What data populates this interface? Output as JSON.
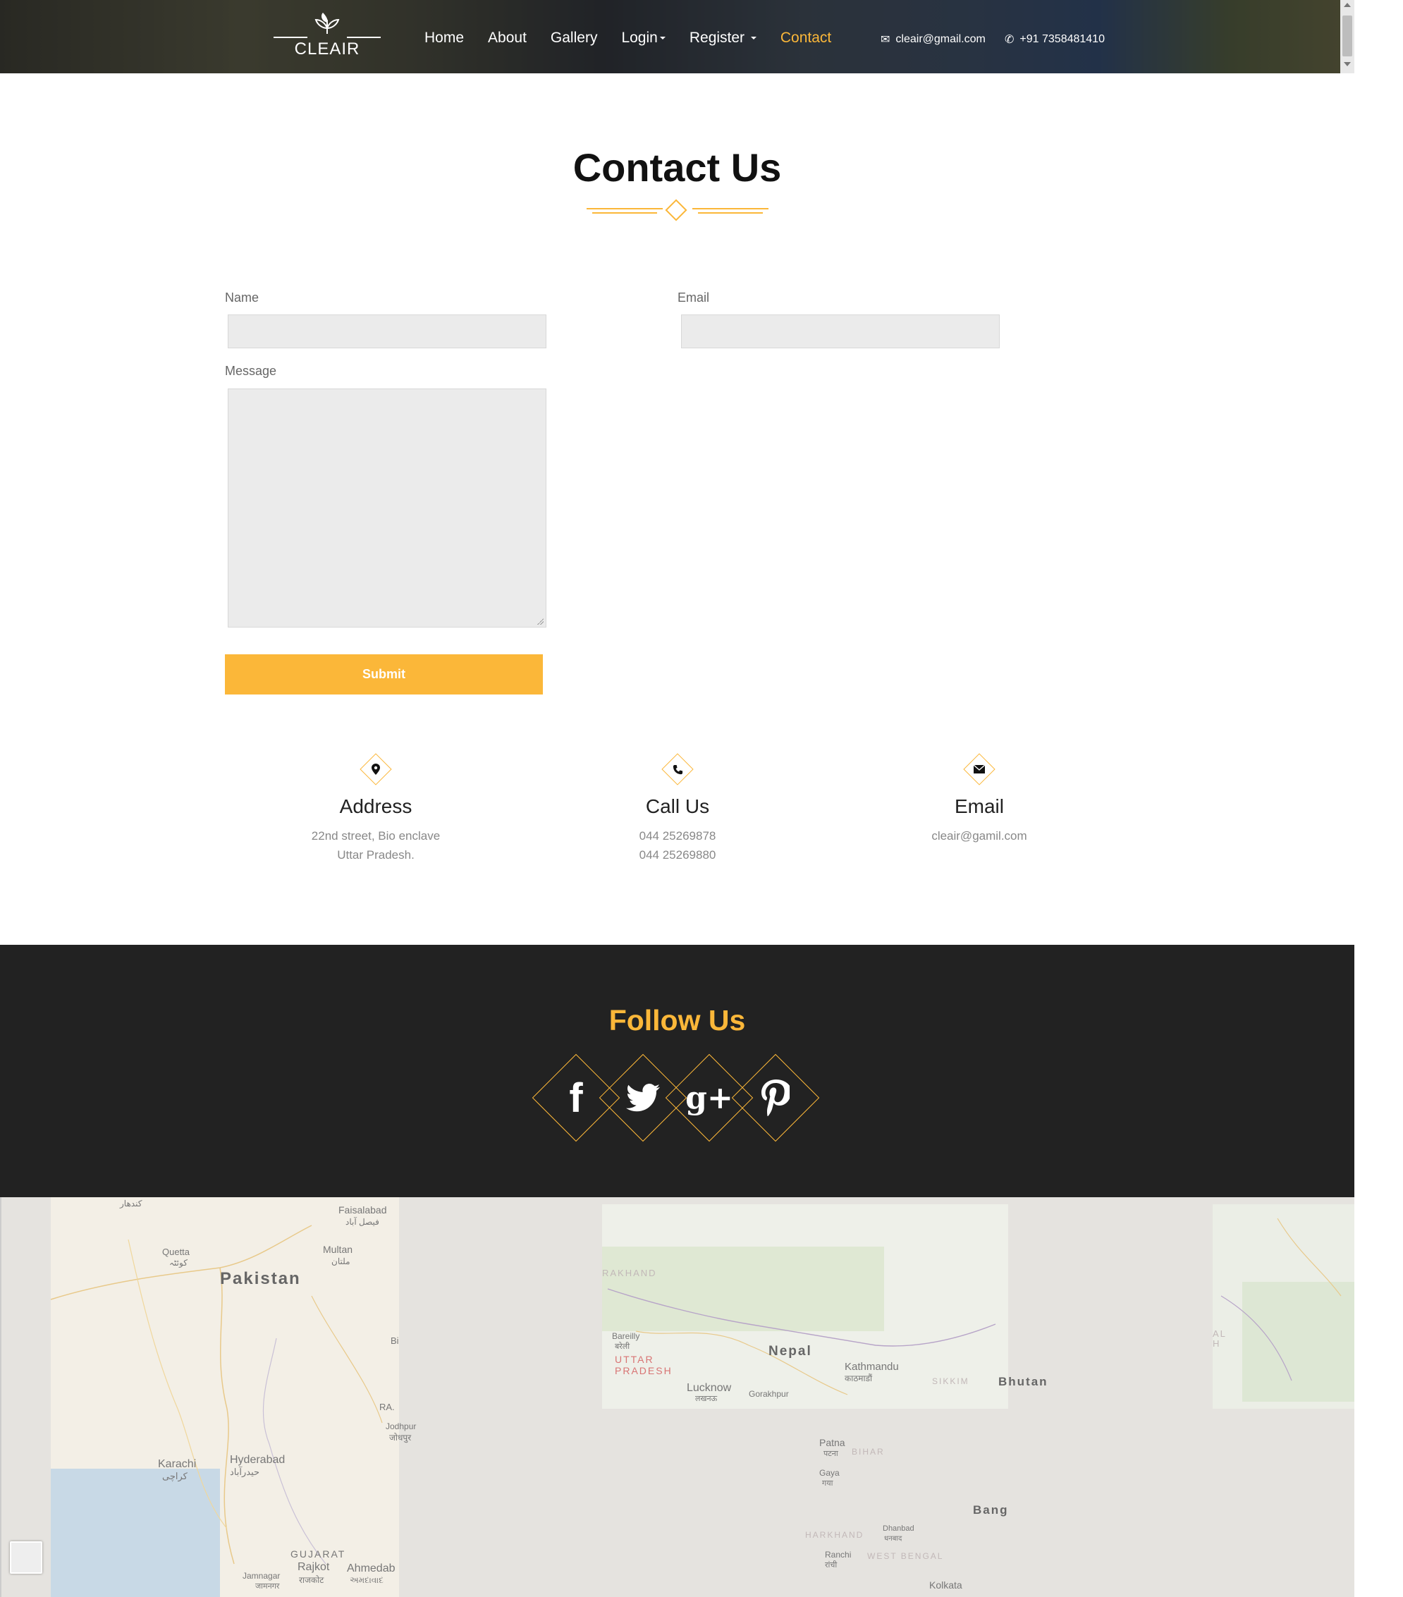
{
  "header": {
    "logo_text": "CLEAIR",
    "nav": [
      {
        "label": "Home",
        "active": false,
        "dropdown": false
      },
      {
        "label": "About",
        "active": false,
        "dropdown": false
      },
      {
        "label": "Gallery",
        "active": false,
        "dropdown": false
      },
      {
        "label": "Login",
        "active": false,
        "dropdown": true
      },
      {
        "label": "Register",
        "active": false,
        "dropdown": true
      },
      {
        "label": "Contact",
        "active": true,
        "dropdown": false
      }
    ],
    "email": "cleair@gmail.com",
    "phone": "+91 7358481410"
  },
  "contact": {
    "title": "Contact Us",
    "form": {
      "name_label": "Name",
      "email_label": "Email",
      "message_label": "Message",
      "name_value": "",
      "email_value": "",
      "message_value": "",
      "submit_label": "Submit"
    },
    "info": [
      {
        "icon": "map-marker-icon",
        "heading": "Address",
        "lines": [
          "22nd street, Bio enclave",
          "Uttar Pradesh."
        ]
      },
      {
        "icon": "phone-icon",
        "heading": "Call Us",
        "lines": [
          "044 25269878",
          "044 25269880"
        ]
      },
      {
        "icon": "envelope-icon",
        "heading": "Email",
        "lines": [
          "cleair@gamil.com"
        ]
      }
    ]
  },
  "follow": {
    "title": "Follow Us",
    "social": [
      {
        "name": "facebook-icon",
        "glyph": "f"
      },
      {
        "name": "twitter-icon",
        "glyph": "🐦"
      },
      {
        "name": "google-plus-icon",
        "glyph": "g+"
      },
      {
        "name": "pinterest-icon",
        "glyph": "P"
      }
    ]
  },
  "map": {
    "labels": [
      "Faisalabad",
      "فیصل آباد",
      "Multan",
      "ملتان",
      "Quetta",
      "کوئٹہ",
      "Pakistan",
      "Karachi",
      "کراچی",
      "Hyderabad",
      "حیدرآباد",
      "Jodhpur",
      "जोधपुर",
      "GUJARAT",
      "Rajkot",
      "राजकोट",
      "Ahmedab",
      "અમદાવાદ",
      "Jamnagar",
      "जामनगर",
      "RAKHAND",
      "UTTAR PRADESH",
      "Bareilly",
      "बरेली",
      "Lucknow",
      "लखनऊ",
      "Nepal",
      "Kathmandu",
      "काठमाडौं",
      "Gorakhpur",
      "SIKKIM",
      "Bhutan",
      "Patna",
      "पटना",
      "BIHAR",
      "Gaya",
      "गया",
      "HARKHAND",
      "Ranchi",
      "रांची",
      "Dhanbad",
      "धनबाद",
      "WEST BENGAL",
      "Bang",
      "Kolkata",
      "RA.",
      "Bi",
      "AL",
      "H",
      "کندهار"
    ]
  }
}
